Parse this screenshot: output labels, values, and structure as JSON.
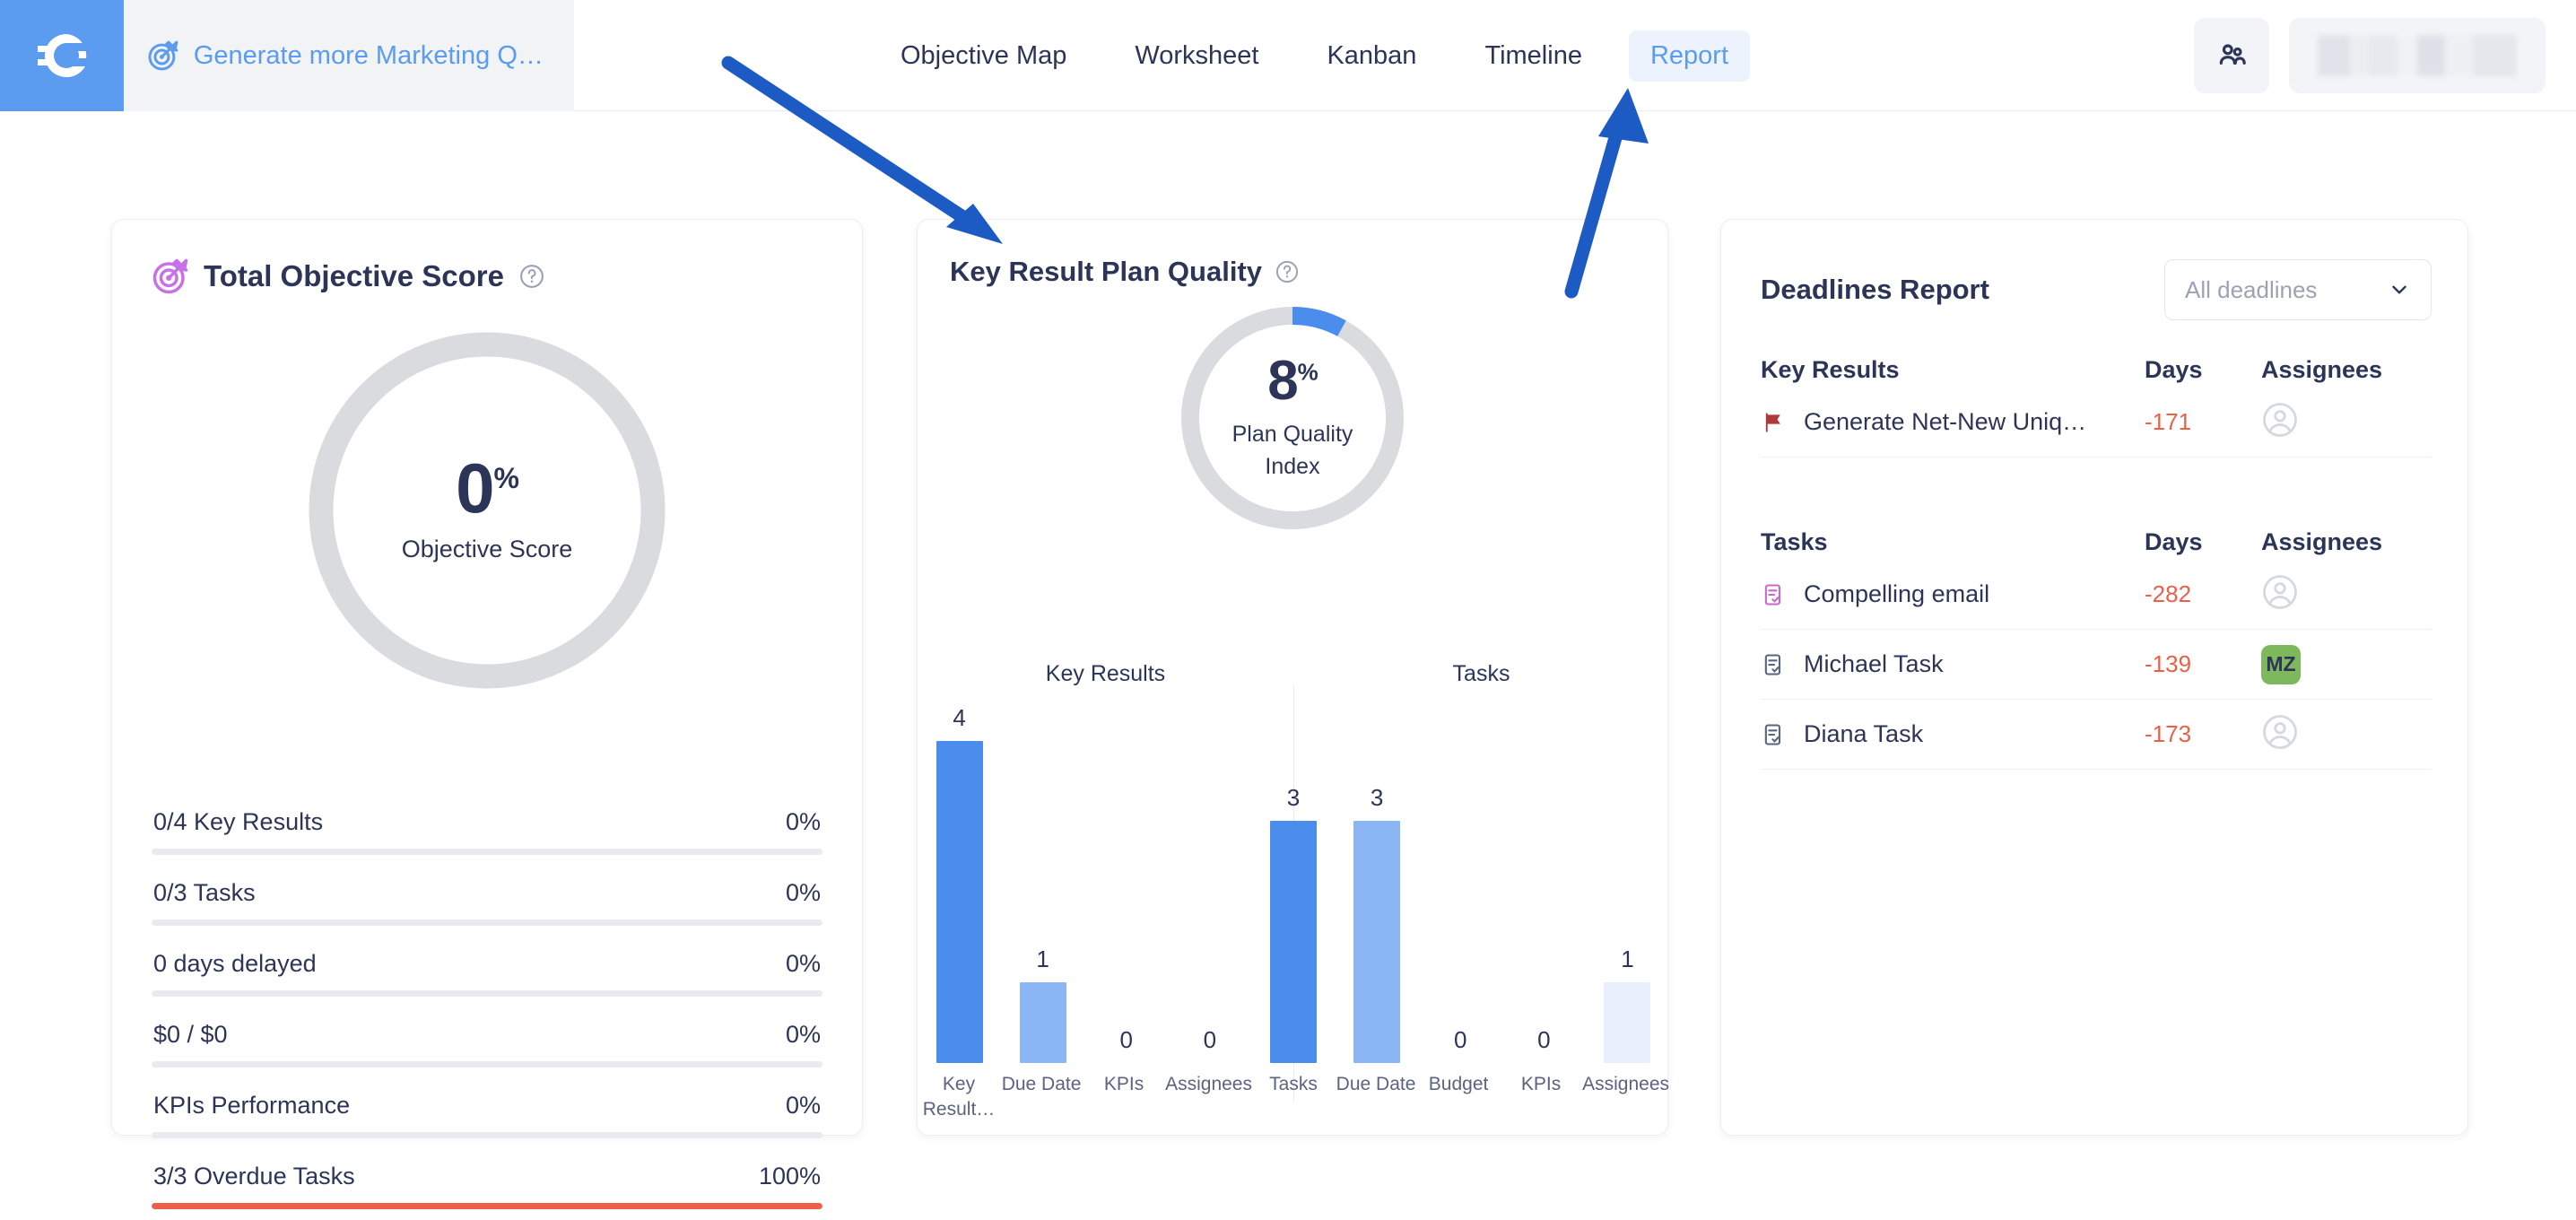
{
  "topbar": {
    "logo_icon": "gtmhub-logo-icon",
    "objective_icon": "target-icon",
    "objective_title": "Generate more Marketing Qua…",
    "nav": [
      {
        "label": "Objective Map",
        "active": false
      },
      {
        "label": "Worksheet",
        "active": false
      },
      {
        "label": "Kanban",
        "active": false
      },
      {
        "label": "Timeline",
        "active": false
      },
      {
        "label": "Report",
        "active": true
      }
    ],
    "people_icon": "people-icon",
    "user_chip_label": ""
  },
  "objective_card": {
    "icon": "target-icon",
    "title": "Total Objective Score",
    "help_icon": "help-circle-icon",
    "gauge": {
      "value": "0",
      "unit": "%",
      "caption": "Objective Score",
      "percent": 0,
      "track_color": "#d9dbdf",
      "fill_color": "#5b9bf0"
    },
    "metrics": [
      {
        "name": "0/4 Key Results",
        "value": "0%",
        "percent": 0,
        "color": "#ea6048"
      },
      {
        "name": "0/3 Tasks",
        "value": "0%",
        "percent": 0,
        "color": "#ea6048"
      },
      {
        "name": "0 days delayed",
        "value": "0%",
        "percent": 0,
        "color": "#ea6048"
      },
      {
        "name": "$0 / $0",
        "value": "0%",
        "percent": 0,
        "color": "#ea6048"
      },
      {
        "name": "KPIs Performance",
        "value": "0%",
        "percent": 0,
        "color": "#ea6048"
      },
      {
        "name": "3/3 Overdue Tasks",
        "value": "100%",
        "percent": 100,
        "color": "#ea6048"
      }
    ]
  },
  "quality_card": {
    "title": "Key Result Plan Quality",
    "help_icon": "help-circle-icon",
    "gauge": {
      "value": "8",
      "unit": "%",
      "caption_line1": "Plan Quality",
      "caption_line2": "Index",
      "percent": 8,
      "track_color": "#d9dbdf",
      "fill_color": "#4a8ded"
    }
  },
  "deadlines_card": {
    "title": "Deadlines Report",
    "filter": {
      "value": "All deadlines",
      "chevron_icon": "chevron-down-icon"
    },
    "key_results": {
      "columns": [
        "Key Results",
        "Days",
        "Assignees"
      ],
      "rows": [
        {
          "icon": "flag-icon",
          "name": "Generate Net-New Unique le…",
          "days": "-171",
          "assignee": "",
          "assignee_type": "placeholder"
        }
      ]
    },
    "tasks": {
      "columns": [
        "Tasks",
        "Days",
        "Assignees"
      ],
      "rows": [
        {
          "icon": "task-icon-pink",
          "name": "Compelling email",
          "days": "-282",
          "assignee": "",
          "assignee_type": "placeholder"
        },
        {
          "icon": "task-icon",
          "name": "Michael Task",
          "days": "-139",
          "assignee": "MZ",
          "assignee_type": "initials"
        },
        {
          "icon": "task-icon",
          "name": "Diana Task",
          "days": "-173",
          "assignee": "",
          "assignee_type": "placeholder"
        }
      ]
    }
  },
  "annotations": {
    "arrow1": "arrow-to-key-result-plan-quality",
    "arrow2": "arrow-to-report-tab",
    "color": "#1d5bc4"
  },
  "chart_data": {
    "type": "bar",
    "title": "Key Result Plan Quality",
    "xlabel": "",
    "ylabel": "",
    "ylim": [
      0,
      4
    ],
    "grid": false,
    "legend": "none",
    "groups": [
      {
        "name": "Key Results",
        "categories": [
          "Key Result…",
          "Due Date",
          "KPIs",
          "Assignees"
        ],
        "values": [
          4,
          1,
          0,
          0
        ],
        "colors": [
          "#4a8ded",
          "#8ab6f5",
          "#e8f0fd",
          "#e8f0fd"
        ]
      },
      {
        "name": "Tasks",
        "categories": [
          "Tasks",
          "Due Date",
          "Budget",
          "KPIs",
          "Assignees"
        ],
        "values": [
          3,
          3,
          0,
          0,
          1
        ],
        "colors": [
          "#4a8ded",
          "#8ab6f5",
          "#e8f0fd",
          "#e8f0fd",
          "#e8f0fd"
        ]
      }
    ],
    "donut": {
      "label": "Plan Quality Index",
      "value": 8,
      "unit": "%"
    }
  }
}
